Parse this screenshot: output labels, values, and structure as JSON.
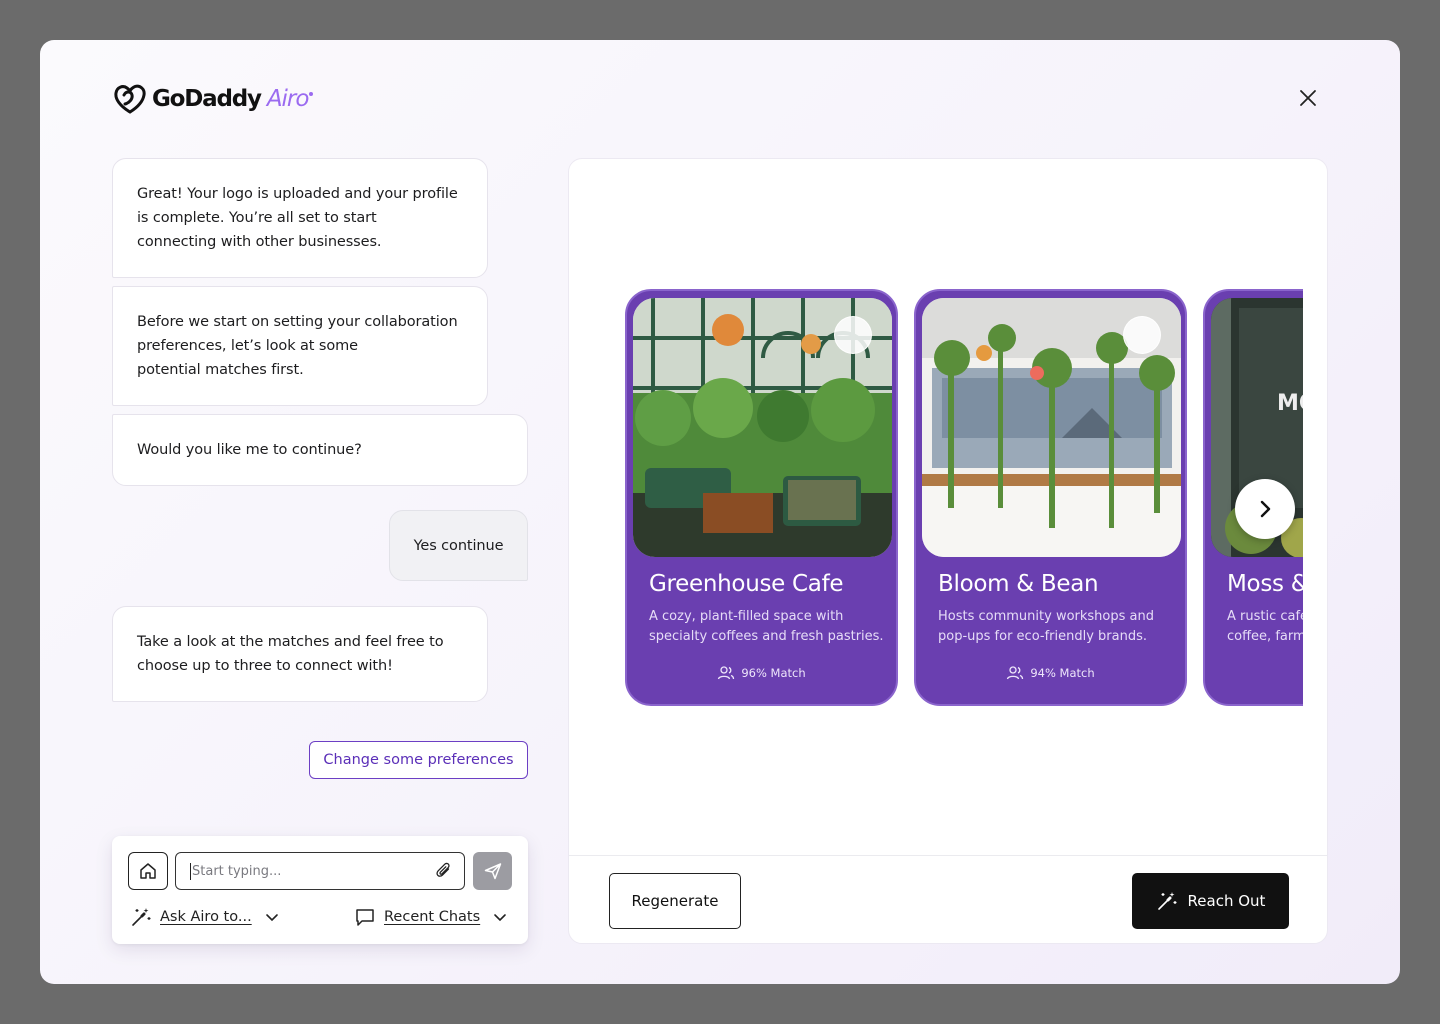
{
  "brand": {
    "name": "GoDaddy",
    "product": "Airo",
    "accent": "#9b6bf0"
  },
  "chat": {
    "messages": [
      {
        "from": "assistant",
        "lines": [
          "Great! Your logo is uploaded and your profile",
          "is complete. You’re all set to start",
          "connecting with other businesses."
        ]
      },
      {
        "from": "assistant",
        "lines": [
          "Before we start on setting your collaboration",
          "preferences, let’s look at some",
          "potential matches first."
        ]
      },
      {
        "from": "assistant",
        "lines": [
          "Would you like me to continue?"
        ]
      },
      {
        "from": "user",
        "lines": [
          "Yes continue"
        ]
      },
      {
        "from": "assistant",
        "lines": [
          "Take a look at the matches and feel free to",
          "choose up to three to connect with!"
        ]
      }
    ],
    "change_preferences_label": "Change some preferences"
  },
  "composer": {
    "placeholder": "Start typing...",
    "value": "",
    "ask_label": "Ask Airo to...",
    "recent_label": "Recent Chats",
    "home_icon": "home-icon",
    "attach_icon": "paperclip-icon",
    "send_icon": "send-icon"
  },
  "matches": [
    {
      "title": "Greenhouse Cafe",
      "desc_lines": [
        "A cozy, plant-filled space with",
        "specialty coffees and fresh pastries."
      ],
      "match": "96% Match"
    },
    {
      "title": "Bloom & Bean",
      "desc_lines": [
        "Hosts community workshops and",
        "pop-ups for eco-friendly brands."
      ],
      "match": "94% Match"
    },
    {
      "title": "Moss & ",
      "desc_lines": [
        "A rustic café",
        "coffee, farm"
      ],
      "match": "",
      "partial": true
    }
  ],
  "actions": {
    "regenerate_label": "Regenerate",
    "reach_out_label": "Reach Out"
  },
  "colors": {
    "card_purple": "#6a3fb0",
    "outline_purple": "#6c3fc4",
    "dark_button": "#111111"
  }
}
